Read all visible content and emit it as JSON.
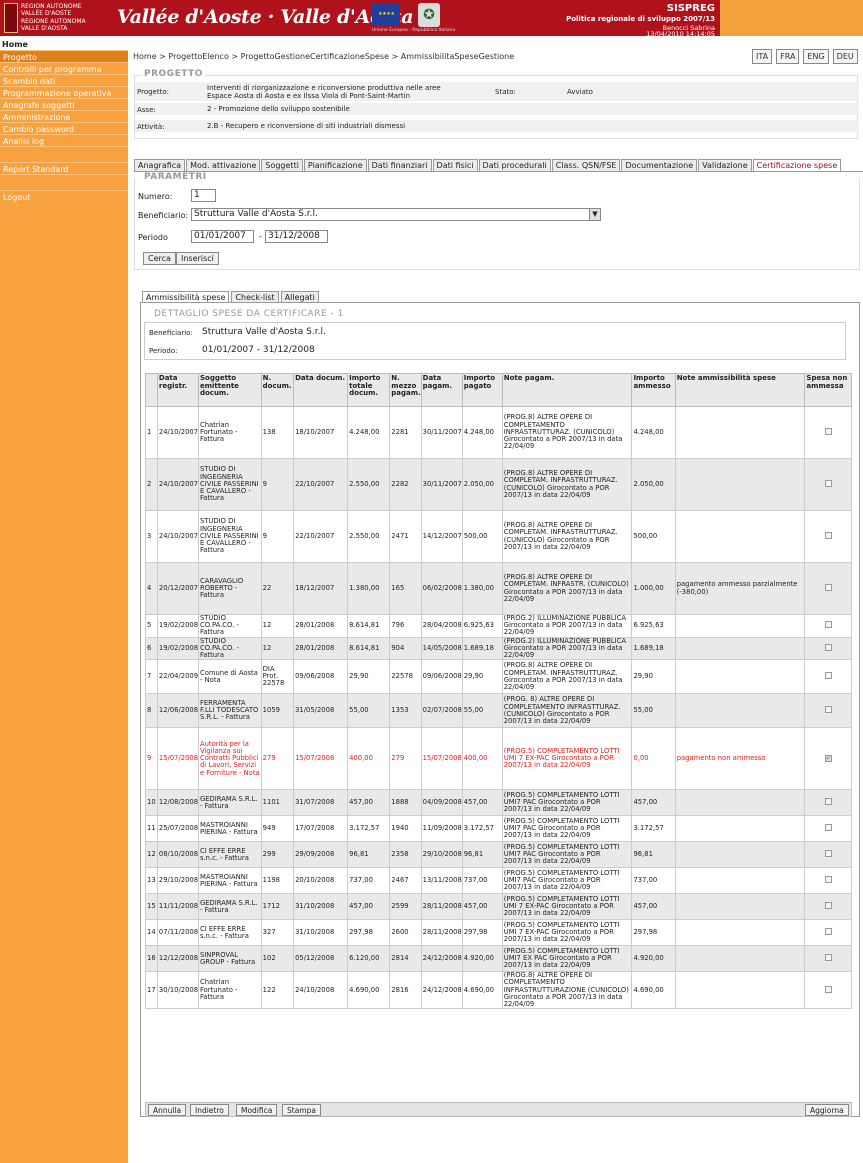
{
  "header": {
    "region_fr": [
      "REGION AUTONOME",
      "VALLÉE D'AOSTE"
    ],
    "region_it": [
      "REGIONE AUTONOMA",
      "VALLE D'AOSTA"
    ],
    "logo": "Vallée d'Aoste · Valle d'Aosta",
    "eu_caption": "Unione Europea - Repubblica Italiana",
    "app": "SISPREG",
    "subtitle": "Politica regionale di sviluppo 2007/13",
    "user": "Benocci Sabrina",
    "datetime": "13/04/2010 14:14:05"
  },
  "sidebar": {
    "home": "Home",
    "items": [
      "Progetto",
      "Controlli per programma",
      "Scambio dati",
      "Programmazione operativa",
      "Anagrafe soggetti",
      "Amministrazione",
      "Cambio password",
      "Analisi log"
    ],
    "report": "Report Standard",
    "logout": "Logout"
  },
  "breadcrumb": "Home > ProgettoElenco > ProgettoGestioneCertificazioneSpese > AmmissibilitaSpeseGestione",
  "languages": [
    "ITA",
    "FRA",
    "ENG",
    "DEU"
  ],
  "progetto": {
    "title": "PROGETTO",
    "progetto_label": "Progetto:",
    "progetto_value_1": "Interventi di riorganizzazione e riconversione produttiva nelle aree",
    "progetto_value_2": "Espace Aosta di Aosta e ex Ilssa Viola di Pont-Saint-Martin",
    "stato_label": "Stato:",
    "stato_value": "Avviato",
    "asse_label": "Asse:",
    "asse_value": "2 - Promozione dello sviluppo sostenibile",
    "attivita_label": "Attività:",
    "attivita_value": "2.B - Recupero e riconversione di siti industriali dismessi"
  },
  "tabs": [
    "Anagrafica",
    "Mod. attivazione",
    "Soggetti",
    "Pianificazione",
    "Dati finanziari",
    "Dati fisici",
    "Dati procedurali",
    "Class. QSN/FSE",
    "Documentazione",
    "Validazione",
    "Certificazione spese"
  ],
  "parametri": {
    "title": "PARAMETRI",
    "numero_label": "Numero:",
    "numero_value": "1",
    "beneficiario_label": "Beneficiario:",
    "beneficiario_value": "Struttura Valle d'Aosta S.r.l.",
    "periodo_label": "Periodo",
    "periodo_from": "01/01/2007",
    "periodo_sep": "-",
    "periodo_to": "31/12/2008",
    "cerca": "Cerca",
    "inserisci": "Inserisci"
  },
  "subtabs": [
    "Ammissibilità spese",
    "Check-list",
    "Allegati"
  ],
  "dettaglio": {
    "title": "DETTAGLIO SPESE DA CERTIFICARE - 1",
    "beneficiario_label": "Beneficiario:",
    "beneficiario_value": "Struttura Valle d'Aosta S.r.l.",
    "periodo_label": "Periodo:",
    "periodo_value": "01/01/2007 - 31/12/2008"
  },
  "table": {
    "headers": [
      "",
      "Data registr.",
      "Soggetto emittente docum.",
      "N. docum.",
      "Data docum.",
      "Importo totale docum.",
      "N. mezzo pagam.",
      "Data pagam.",
      "Importo pagato",
      "Note pagam.",
      "Importo ammesso",
      "Note ammissibilità spese",
      "Spesa non ammessa"
    ],
    "rows": [
      {
        "n": "1",
        "data": "24/10/2007",
        "sogg": "Chatrian Fortunato - Fattura",
        "ndoc": "138",
        "ddoc": "18/10/2007",
        "imp": "4.248,00",
        "nmez": "2281",
        "dpag": "30/11/2007",
        "pag": "4.248,00",
        "note": "(PROG.8) ALTRE OPERE DI COMPLETAMENTO INFRASTRUTTURAZ. (CUNICOLO) Girocontato a POR 2007/13 in data 22/04/09",
        "amm": "4.248,00",
        "nota": "",
        "checked": false
      },
      {
        "n": "2",
        "data": "24/10/2007",
        "sogg": "STUDIO DI INGEGNERIA CIVILE PASSERINI E CAVALLERO - Fattura",
        "ndoc": "9",
        "ddoc": "22/10/2007",
        "imp": "2.550,00",
        "nmez": "2282",
        "dpag": "30/11/2007",
        "pag": "2.050,00",
        "note": "(PROG.8) ALTRE OPERE DI COMPLETAM. INFRASTRUTTURAZ. (CUNICOLO) Girocontato a POR 2007/13 in data 22/04/09",
        "amm": "2.050,00",
        "nota": "",
        "checked": false
      },
      {
        "n": "3",
        "data": "24/10/2007",
        "sogg": "STUDIO DI INGEGNERIA CIVILE PASSERINI E CAVALLERO - Fattura",
        "ndoc": "9",
        "ddoc": "22/10/2007",
        "imp": "2.550,00",
        "nmez": "2471",
        "dpag": "14/12/2007",
        "pag": "500,00",
        "note": "(PROG.8) ALTRE OPERE DI COMPLETAM. INFRASTRUTTURAZ. (CUNICOLO) Girocontato a POR 2007/13 in data 22/04/09",
        "amm": "500,00",
        "nota": "",
        "checked": false
      },
      {
        "n": "4",
        "data": "20/12/2007",
        "sogg": "CARAVAGLIO ROBERTO - Fattura",
        "ndoc": "22",
        "ddoc": "18/12/2007",
        "imp": "1.380,00",
        "nmez": "165",
        "dpag": "06/02/2008",
        "pag": "1.380,00",
        "note": "(PROG.8) ALTRE OPERE DI COMPLETAM. INFRASTR. (CUNICOLO) Girocontato a POR 2007/13 in data 22/04/09",
        "amm": "1.000,00",
        "nota": "pagamento ammesso parzialmente (-380,00)",
        "checked": false
      },
      {
        "n": "5",
        "data": "19/02/2008",
        "sogg": "STUDIO CO.PA.CO. - Fattura",
        "ndoc": "12",
        "ddoc": "28/01/2008",
        "imp": "8.614,81",
        "nmez": "796",
        "dpag": "28/04/2008",
        "pag": "6.925,63",
        "note": "(PROG.2) ILLUMINAZIONE PUBBLICA Girocontato a POR 2007/13 in data 22/04/09",
        "amm": "6.925,63",
        "nota": "",
        "checked": false
      },
      {
        "n": "6",
        "data": "19/02/2008",
        "sogg": "STUDIO CO.PA.CO. - Fattura",
        "ndoc": "12",
        "ddoc": "28/01/2008",
        "imp": "8.614,81",
        "nmez": "904",
        "dpag": "14/05/2008",
        "pag": "1.689,18",
        "note": "(PROG.2) ILLUMINAZIONE PUBBLICA Girocontato a POR 2007/13 in data 22/04/09",
        "amm": "1.689,18",
        "nota": "",
        "checked": false
      },
      {
        "n": "7",
        "data": "22/04/2009",
        "sogg": "Comune di Aosta - Nota",
        "ndoc": "DIA Prot. 22578",
        "ddoc": "09/06/2008",
        "imp": "29,90",
        "nmez": "22578",
        "dpag": "09/06/2008",
        "pag": "29,90",
        "note": "(PROG.8) ALTRE OPERE DI COMPLETAM. INFRASTRUTTURAZ. Girocontato a POR 2007/13 in data 22/04/09",
        "amm": "29,90",
        "nota": "",
        "checked": false
      },
      {
        "n": "8",
        "data": "12/06/2008",
        "sogg": "FERRAMENTA F.LLI TODESCATO S.R.L. - Fattura",
        "ndoc": "1059",
        "ddoc": "31/05/2008",
        "imp": "55,00",
        "nmez": "1353",
        "dpag": "02/07/2008",
        "pag": "55,00",
        "note": "(PROG. 8) ALTRE OPERE DI COMPLETAMENTO INFRASTTURAZ. (CUNICOLO) Girocontato a POR 2007/13 in data 22/04/09",
        "amm": "55,00",
        "nota": "",
        "checked": false
      },
      {
        "n": "9",
        "data": "15/07/2008",
        "sogg": "Autorità per la Vigilanza sui Contratti Pubblici di Lavori, Servizi e Forniture - Nota",
        "ndoc": "279",
        "ddoc": "15/07/2008",
        "imp": "400,00",
        "nmez": "279",
        "dpag": "15/07/2008",
        "pag": "400,00",
        "note": "(PROG.5) COMPLETAMENTO LOTTI UMI 7 EX-PAC Girocontato a POR 2007/13 in data 22/04/09",
        "amm": "0,00",
        "nota": "pagamento non ammesso",
        "checked": true
      },
      {
        "n": "10",
        "data": "12/08/2008",
        "sogg": "GEDIRAMA S.R.L. - Fattura",
        "ndoc": "1101",
        "ddoc": "31/07/2008",
        "imp": "457,00",
        "nmez": "1888",
        "dpag": "04/09/2008",
        "pag": "457,00",
        "note": "(PROG.5) COMPLETAMENTO LOTTI UMI7 PAC Girocontato a POR 2007/13 in data 22/04/09",
        "amm": "457,00",
        "nota": "",
        "checked": false
      },
      {
        "n": "11",
        "data": "25/07/2008",
        "sogg": "MASTROIANNI PIERINA - Fattura",
        "ndoc": "949",
        "ddoc": "17/07/2008",
        "imp": "3.172,57",
        "nmez": "1940",
        "dpag": "11/09/2008",
        "pag": "3.172,57",
        "note": "(PROG.5) COMPLETAMENTO LOTTI UMI7 PAC Girocontato a POR 2007/13 in data 22/04/09",
        "amm": "3.172,57",
        "nota": "",
        "checked": false
      },
      {
        "n": "12",
        "data": "08/10/2008",
        "sogg": "CI EFFE ERRE s.n.c. - Fattura",
        "ndoc": "299",
        "ddoc": "29/09/2008",
        "imp": "96,81",
        "nmez": "2358",
        "dpag": "29/10/2008",
        "pag": "96,81",
        "note": "(PROG.5) COMPLETAMENTO LOTTI UMI7 PAC Girocontato a POR 2007/13 in data 22/04/09",
        "amm": "96,81",
        "nota": "",
        "checked": false
      },
      {
        "n": "13",
        "data": "29/10/2008",
        "sogg": "MASTROIANNI PIERINA - Fattura",
        "ndoc": "1198",
        "ddoc": "20/10/2008",
        "imp": "737,00",
        "nmez": "2467",
        "dpag": "13/11/2008",
        "pag": "737,00",
        "note": "(PROG.5) COMPLETAMENTO LOTTI UMI7 PAC Girocontato a POR 2007/13 in data 22/04/09",
        "amm": "737,00",
        "nota": "",
        "checked": false
      },
      {
        "n": "15",
        "data": "11/11/2008",
        "sogg": "GEDIRAMA S.R.L. - Fattura",
        "ndoc": "1712",
        "ddoc": "31/10/2008",
        "imp": "457,00",
        "nmez": "2599",
        "dpag": "28/11/2008",
        "pag": "457,00",
        "note": "(PROG.5) COMPLETAMENTO LOTTI UMI 7 EX-PAC Girocontato a POR 2007/13 in data 22/04/09",
        "amm": "457,00",
        "nota": "",
        "checked": false
      },
      {
        "n": "14",
        "data": "07/11/2008",
        "sogg": "CI EFFE ERRE s.n.c. - Fattura",
        "ndoc": "327",
        "ddoc": "31/10/2008",
        "imp": "297,98",
        "nmez": "2600",
        "dpag": "28/11/2008",
        "pag": "297,98",
        "note": "(PROG.5) COMPLETAMENTO LOTTI UMI 7 EX-PAC Girocontato a POR 2007/13 in data 22/04/09",
        "amm": "297,98",
        "nota": "",
        "checked": false
      },
      {
        "n": "16",
        "data": "12/12/2008",
        "sogg": "SINPROVAL GROUP - Fattura",
        "ndoc": "102",
        "ddoc": "05/12/2008",
        "imp": "6.120,00",
        "nmez": "2814",
        "dpag": "24/12/2008",
        "pag": "4.920,00",
        "note": "(PROG.5) COMPLETAMENTO LOTTI UMI7 EX PAC Girocontato a POR 2007/13 in data 22/04/09",
        "amm": "4.920,00",
        "nota": "",
        "checked": false
      },
      {
        "n": "17",
        "data": "30/10/2008",
        "sogg": "Chatrian Fortunato - Fattura",
        "ndoc": "122",
        "ddoc": "24/10/2008",
        "imp": "4.690,00",
        "nmez": "2816",
        "dpag": "24/12/2008",
        "pag": "4.690,00",
        "note": "(PROG.8) ALTRE OPERE DI COMPLETAMENTO INFRASTRUTTURAZIONE (CUNICOLO) Girocontato a POR 2007/13 in data 22/04/09",
        "amm": "4.690,00",
        "nota": "",
        "checked": false
      }
    ]
  },
  "bottom": {
    "annulla": "Annulla",
    "indietro": "Indietro",
    "modifica": "Modifica",
    "stampa": "Stampa",
    "aggiorna": "Aggiorna"
  },
  "colors": {
    "header_red": "#b0121c",
    "sidebar_orange": "#f7a23f",
    "error_red": "#e0201c"
  },
  "icons": [
    "crest-icon",
    "eu-flag-icon",
    "italian-emblem-icon",
    "dropdown-arrow-icon",
    "checkbox-icon"
  ]
}
